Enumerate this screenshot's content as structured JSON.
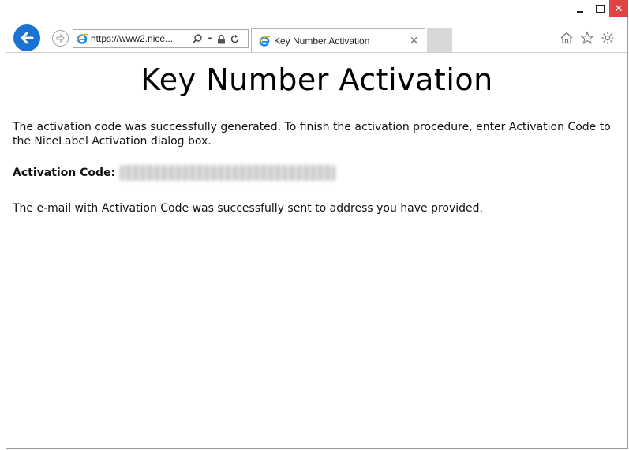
{
  "browser": {
    "address_url": "https://www2.nice...",
    "tab_title": "Key Number Activation",
    "tab_close": "×",
    "close_glyph": "✕"
  },
  "page": {
    "title": "Key Number Activation",
    "message": "The activation code was successfully generated. To finish the activation procedure, enter Activation Code to the NiceLabel Activation dialog box.",
    "activation_label": "Activation Code:",
    "email_message": "The e-mail with Activation Code was successfully sent to address you have provided."
  },
  "colors": {
    "back_button": "#1a73d3",
    "close_button": "#e04343",
    "ie_icon": "#1e88e5"
  }
}
